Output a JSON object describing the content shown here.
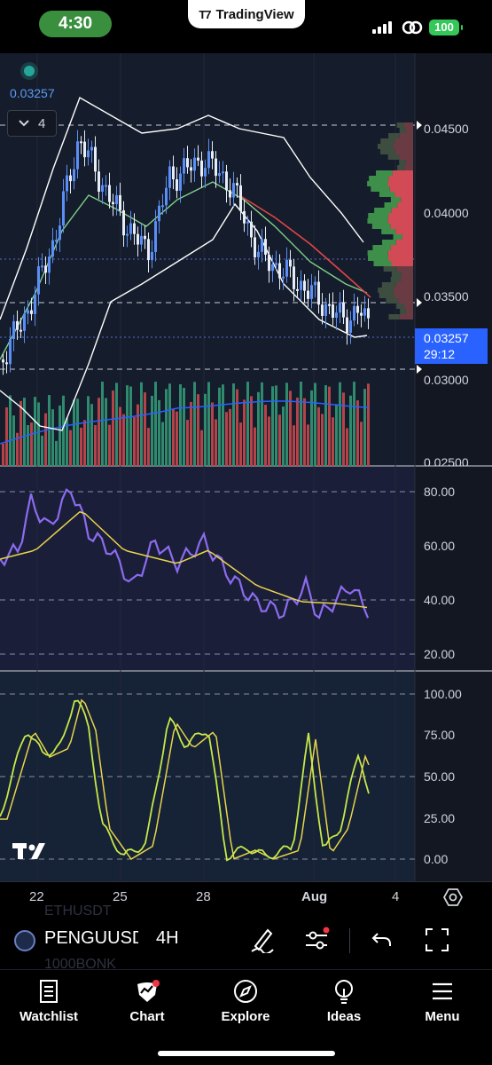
{
  "status_bar": {
    "time": "4:30",
    "app_tab": "TradingView",
    "battery": "100"
  },
  "chart": {
    "last_price_top": "0.03257",
    "collapse_count": "4",
    "price_axis": [
      "0.04500",
      "0.04000",
      "0.03500",
      "0.03000",
      "0.02500"
    ],
    "price_badge": {
      "price": "0.03257",
      "countdown": "29:12"
    },
    "rsi_axis": [
      "80.00",
      "60.00",
      "40.00",
      "20.00"
    ],
    "stoch_axis": [
      "100.00",
      "75.00",
      "50.00",
      "25.00",
      "0.00"
    ],
    "date_axis": [
      "22",
      "25",
      "28",
      "Aug",
      "4"
    ]
  },
  "symbol_bar": {
    "symbol": "PENGUUSDT",
    "interval": "4H",
    "ghost_above": "ETHUSDT",
    "ghost_below": "1000BONK"
  },
  "nav": [
    {
      "label": "Watchlist",
      "icon": "watchlist-icon"
    },
    {
      "label": "Chart",
      "icon": "chart-icon"
    },
    {
      "label": "Explore",
      "icon": "compass-icon"
    },
    {
      "label": "Ideas",
      "icon": "lightbulb-icon"
    },
    {
      "label": "Menu",
      "icon": "hamburger-icon"
    }
  ],
  "colors": {
    "up": "#5b8ff5",
    "down": "#e6edf7",
    "volume_up": "#2f8a6e",
    "volume_down": "#b5434a",
    "rsi": "#8b6cf0",
    "rsi_ma": "#e8d44d",
    "stoch_k": "#c6e84a",
    "stoch_d": "#e8d44d",
    "accent": "#2962ff"
  }
}
